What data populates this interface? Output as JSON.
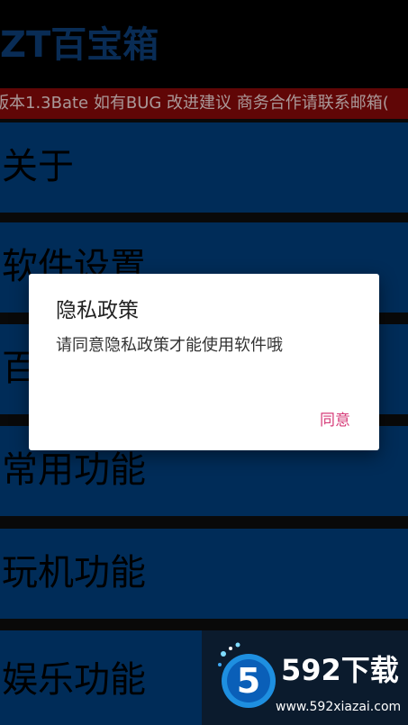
{
  "app_bar": {
    "title": "ZT百宝箱"
  },
  "notice": {
    "text": "版本1.3Bate 如有BUG 改进建议 商务合作请联系邮箱("
  },
  "menu": {
    "items": [
      {
        "label": "关于"
      },
      {
        "label": "软件设置"
      },
      {
        "label": "百"
      },
      {
        "label": "常用功能"
      },
      {
        "label": "玩机功能"
      },
      {
        "label": "娱乐功能"
      }
    ]
  },
  "dialog": {
    "title": "隐私政策",
    "message": "请同意隐私政策才能使用软件哦",
    "agree_label": "同意"
  },
  "watermark": {
    "logo_text": "5",
    "brand": "592下载",
    "url": "www.592xiazai.com"
  },
  "colors": {
    "app_bar_bg": "#000000",
    "title": "#0d3f7a",
    "notice_bg": "#8a0a0a",
    "menu_bg": "#003f7e",
    "accent": "#d63c79"
  }
}
